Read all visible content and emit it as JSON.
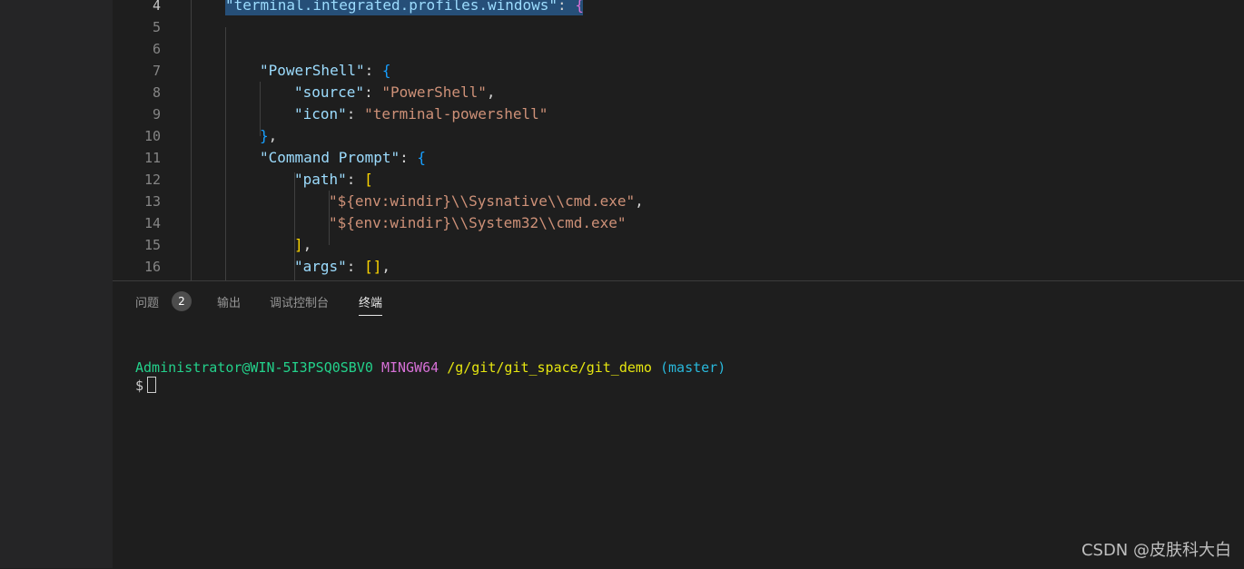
{
  "editor": {
    "lines": [
      {
        "num": "4",
        "active": true,
        "indent": 1,
        "tokens": [
          {
            "t": "\"terminal.integrated.profiles.windows\"",
            "c": "k"
          },
          {
            "t": ": ",
            "c": "p"
          },
          {
            "t": "{",
            "c": "b2"
          }
        ]
      },
      {
        "num": "5",
        "indent": 0,
        "tokens": []
      },
      {
        "num": "6",
        "indent": 0,
        "tokens": []
      },
      {
        "num": "7",
        "indent": 2,
        "tokens": [
          {
            "t": "\"PowerShell\"",
            "c": "k"
          },
          {
            "t": ": ",
            "c": "p"
          },
          {
            "t": "{",
            "c": "b3"
          }
        ]
      },
      {
        "num": "8",
        "indent": 3,
        "tokens": [
          {
            "t": "\"source\"",
            "c": "k"
          },
          {
            "t": ": ",
            "c": "p"
          },
          {
            "t": "\"PowerShell\"",
            "c": "s"
          },
          {
            "t": ",",
            "c": "p"
          }
        ]
      },
      {
        "num": "9",
        "indent": 3,
        "tokens": [
          {
            "t": "\"icon\"",
            "c": "k"
          },
          {
            "t": ": ",
            "c": "p"
          },
          {
            "t": "\"terminal-powershell\"",
            "c": "s"
          }
        ]
      },
      {
        "num": "10",
        "indent": 2,
        "tokens": [
          {
            "t": "}",
            "c": "b3"
          },
          {
            "t": ",",
            "c": "p"
          }
        ]
      },
      {
        "num": "11",
        "indent": 2,
        "tokens": [
          {
            "t": "\"Command Prompt\"",
            "c": "k"
          },
          {
            "t": ": ",
            "c": "p"
          },
          {
            "t": "{",
            "c": "b3"
          }
        ]
      },
      {
        "num": "12",
        "indent": 3,
        "tokens": [
          {
            "t": "\"path\"",
            "c": "k"
          },
          {
            "t": ": ",
            "c": "p"
          },
          {
            "t": "[",
            "c": "b1"
          }
        ]
      },
      {
        "num": "13",
        "indent": 4,
        "tokens": [
          {
            "t": "\"${env:windir}\\\\Sysnative\\\\cmd.exe\"",
            "c": "s"
          },
          {
            "t": ",",
            "c": "p"
          }
        ]
      },
      {
        "num": "14",
        "indent": 4,
        "tokens": [
          {
            "t": "\"${env:windir}\\\\System32\\\\cmd.exe\"",
            "c": "s"
          }
        ]
      },
      {
        "num": "15",
        "indent": 3,
        "tokens": [
          {
            "t": "]",
            "c": "b1"
          },
          {
            "t": ",",
            "c": "p"
          }
        ]
      },
      {
        "num": "16",
        "indent": 3,
        "tokens": [
          {
            "t": "\"args\"",
            "c": "k"
          },
          {
            "t": ": ",
            "c": "p"
          },
          {
            "t": "[]",
            "c": "b1"
          },
          {
            "t": ",",
            "c": "p"
          }
        ]
      }
    ]
  },
  "panel": {
    "tabs": [
      {
        "label": "问题",
        "badge": "2",
        "active": false
      },
      {
        "label": "输出",
        "active": false
      },
      {
        "label": "调试控制台",
        "active": false
      },
      {
        "label": "终端",
        "active": true
      }
    ]
  },
  "terminal": {
    "user": "Administrator@WIN-5I3PSQ0SBV0",
    "system": "MINGW64",
    "path": "/g/git/git_space/git_demo",
    "branch": "(master)",
    "prompt": "$"
  },
  "watermark": "CSDN @皮肤科大白"
}
